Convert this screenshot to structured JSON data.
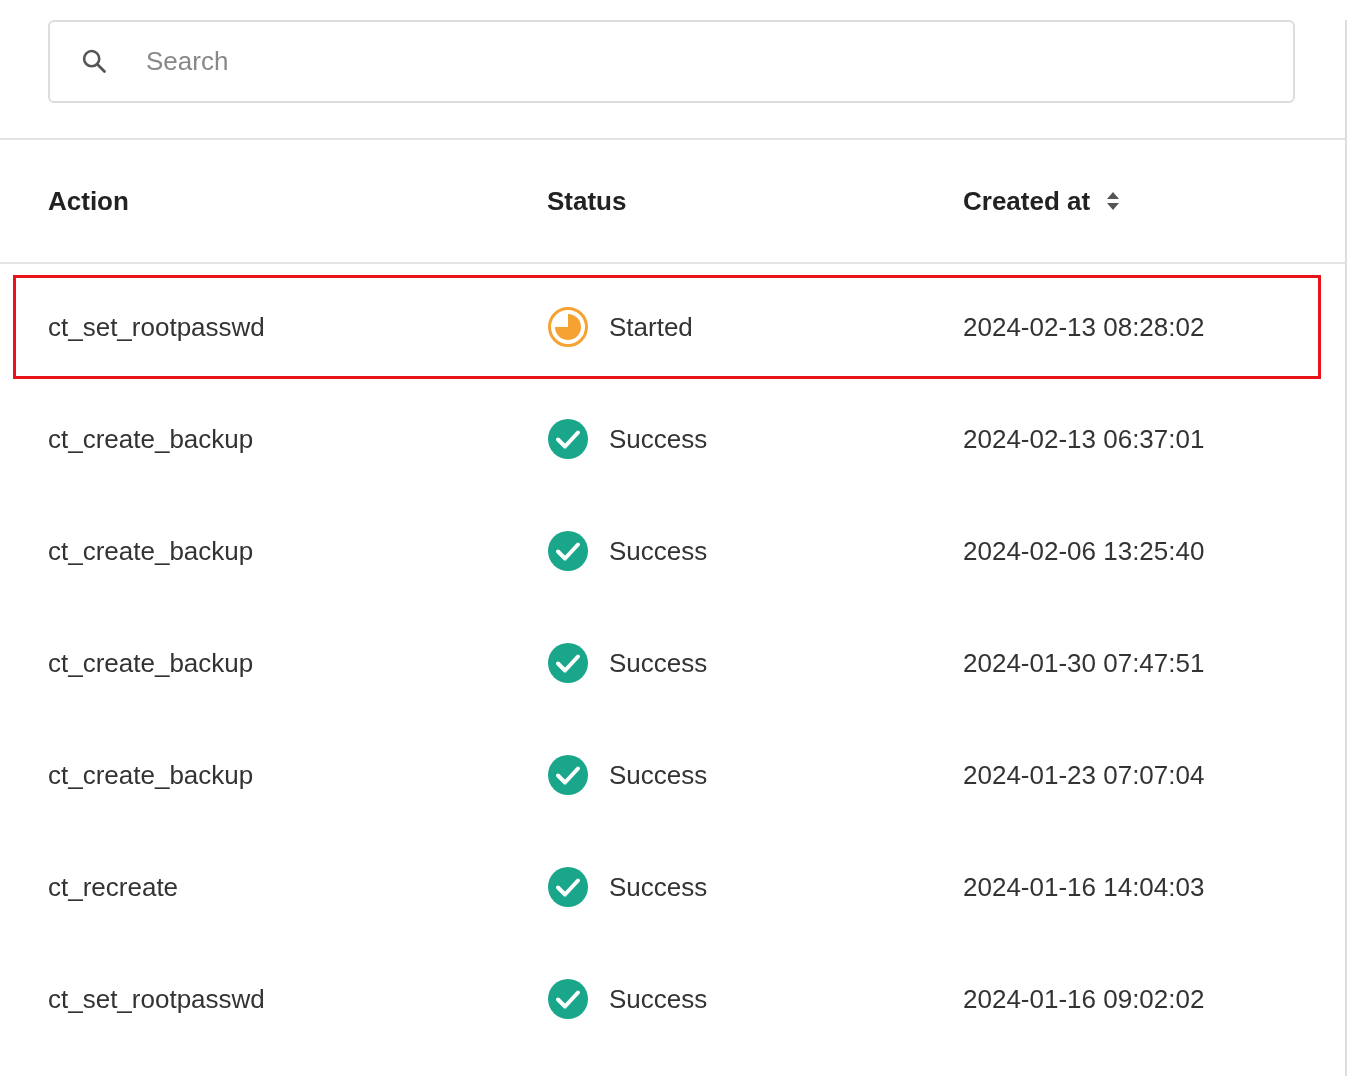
{
  "search": {
    "placeholder": "Search"
  },
  "table": {
    "columns": [
      {
        "label": "Action",
        "sortable": false
      },
      {
        "label": "Status",
        "sortable": false
      },
      {
        "label": "Created at",
        "sortable": true
      }
    ],
    "rows": [
      {
        "action": "ct_set_rootpasswd",
        "status": "Started",
        "kind": "started",
        "created_at": "2024-02-13 08:28:02",
        "highlighted": true
      },
      {
        "action": "ct_create_backup",
        "status": "Success",
        "kind": "success",
        "created_at": "2024-02-13 06:37:01",
        "highlighted": false
      },
      {
        "action": "ct_create_backup",
        "status": "Success",
        "kind": "success",
        "created_at": "2024-02-06 13:25:40",
        "highlighted": false
      },
      {
        "action": "ct_create_backup",
        "status": "Success",
        "kind": "success",
        "created_at": "2024-01-30 07:47:51",
        "highlighted": false
      },
      {
        "action": "ct_create_backup",
        "status": "Success",
        "kind": "success",
        "created_at": "2024-01-23 07:07:04",
        "highlighted": false
      },
      {
        "action": "ct_recreate",
        "status": "Success",
        "kind": "success",
        "created_at": "2024-01-16 14:04:03",
        "highlighted": false
      },
      {
        "action": "ct_set_rootpasswd",
        "status": "Success",
        "kind": "success",
        "created_at": "2024-01-16 09:02:02",
        "highlighted": false
      }
    ]
  }
}
